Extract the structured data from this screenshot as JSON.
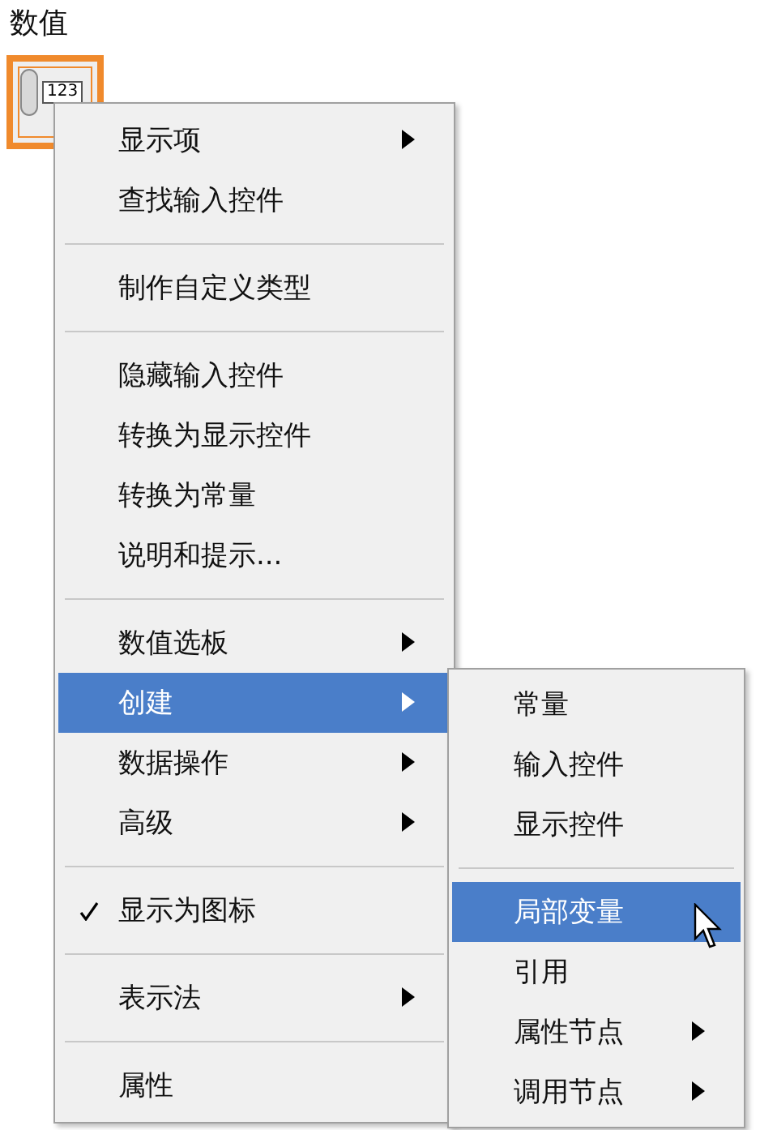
{
  "control": {
    "label": "数值",
    "digits": "123"
  },
  "menu": {
    "groups": [
      [
        {
          "label": "显示项",
          "submenu": true,
          "selected": false,
          "checked": false
        },
        {
          "label": "查找输入控件",
          "submenu": false,
          "selected": false,
          "checked": false
        }
      ],
      [
        {
          "label": "制作自定义类型",
          "submenu": false,
          "selected": false,
          "checked": false
        }
      ],
      [
        {
          "label": "隐藏输入控件",
          "submenu": false,
          "selected": false,
          "checked": false
        },
        {
          "label": "转换为显示控件",
          "submenu": false,
          "selected": false,
          "checked": false
        },
        {
          "label": "转换为常量",
          "submenu": false,
          "selected": false,
          "checked": false
        },
        {
          "label": "说明和提示...",
          "submenu": false,
          "selected": false,
          "checked": false
        }
      ],
      [
        {
          "label": "数值选板",
          "submenu": true,
          "selected": false,
          "checked": false
        },
        {
          "label": "创建",
          "submenu": true,
          "selected": true,
          "checked": false
        },
        {
          "label": "数据操作",
          "submenu": true,
          "selected": false,
          "checked": false
        },
        {
          "label": "高级",
          "submenu": true,
          "selected": false,
          "checked": false
        }
      ],
      [
        {
          "label": "显示为图标",
          "submenu": false,
          "selected": false,
          "checked": true
        }
      ],
      [
        {
          "label": "表示法",
          "submenu": true,
          "selected": false,
          "checked": false
        }
      ],
      [
        {
          "label": "属性",
          "submenu": false,
          "selected": false,
          "checked": false
        }
      ]
    ]
  },
  "submenu": {
    "groups": [
      [
        {
          "label": "常量",
          "submenu": false,
          "selected": false
        },
        {
          "label": "输入控件",
          "submenu": false,
          "selected": false
        },
        {
          "label": "显示控件",
          "submenu": false,
          "selected": false
        }
      ],
      [
        {
          "label": "局部变量",
          "submenu": false,
          "selected": true
        },
        {
          "label": "引用",
          "submenu": false,
          "selected": false
        },
        {
          "label": "属性节点",
          "submenu": true,
          "selected": false
        },
        {
          "label": "调用节点",
          "submenu": true,
          "selected": false
        }
      ]
    ]
  }
}
